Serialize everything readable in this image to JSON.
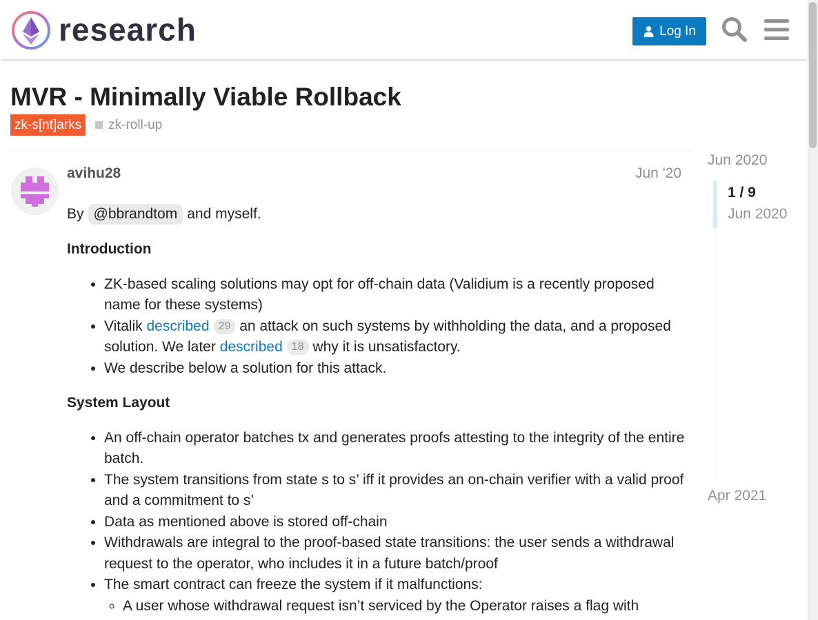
{
  "header": {
    "site_name": "research",
    "login_label": "Log In"
  },
  "topic": {
    "title": "MVR - Minimally Viable Rollback",
    "category": "zk-s[nt]arks",
    "tag": "zk-roll-up"
  },
  "post": {
    "username": "avihu28",
    "date": "Jun '20",
    "byline_prefix": "By",
    "mention": "@bbrandtom",
    "byline_suffix": "and myself.",
    "intro_heading": "Introduction",
    "intro_1": "ZK-based scaling solutions may opt for off-chain data (Validium is a recently proposed name for these systems)",
    "intro_2_a": "Vitalik",
    "intro_2_link1": "described",
    "intro_2_count1": "29",
    "intro_2_b": "an attack on such systems by withholding the data, and a proposed solution. We later",
    "intro_2_link2": "described",
    "intro_2_count2": "18",
    "intro_2_c": "why it is unsatisfactory.",
    "intro_3": "We describe below a solution for this attack.",
    "layout_heading": "System Layout",
    "layout_1": "An off-chain operator batches tx and generates proofs attesting to the integrity of the entire batch.",
    "layout_2": "The system transitions from state s to s’ iff it provides an on-chain verifier with a valid proof and a commitment to s’",
    "layout_3": "Data as mentioned above is stored off-chain",
    "layout_4": "Withdrawals are integral to the proof-based state transitions: the user sends a withdrawal request to the operator, who includes it in a future batch/proof",
    "layout_5": "The smart contract can freeze the system if it malfunctions:",
    "layout_5_sub": "A user whose withdrawal request isn’t serviced by the Operator raises a flag with"
  },
  "timeline": {
    "start": "Jun 2020",
    "position": "1 / 9",
    "current_date": "Jun 2020",
    "end": "Apr 2021"
  },
  "colors": {
    "brand_blue": "#0a7bc1",
    "category_orange": "#f25c2f",
    "avatar_purple": "#cf6fdd"
  }
}
